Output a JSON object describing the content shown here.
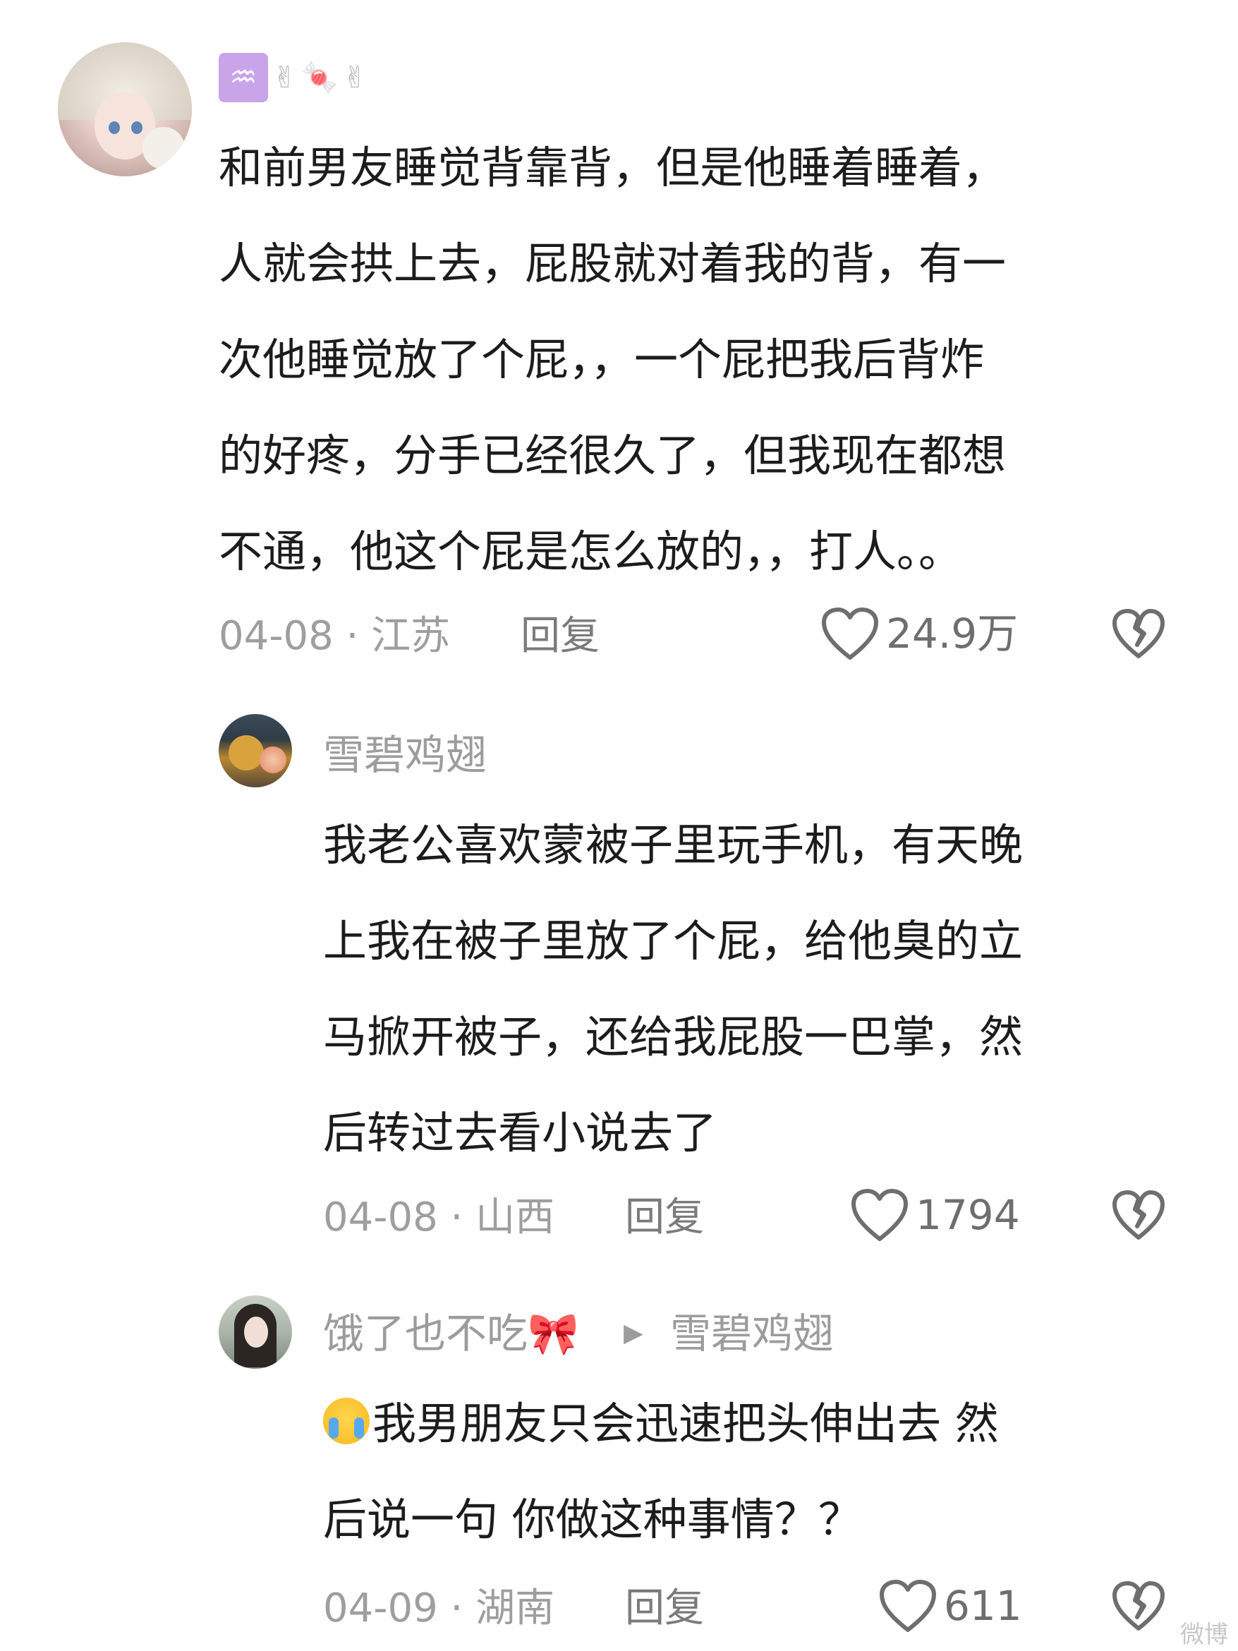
{
  "comments": [
    {
      "username_emojis": [
        "♒",
        "✌",
        "🍬",
        "✌"
      ],
      "text_lines": [
        "和前男友睡觉背靠背，但是他睡着睡着，",
        "人就会拱上去，屁股就对着我的背，有一",
        "次他睡觉放了个屁，，一个屁把我后背炸",
        "的好疼，分手已经很久了，但我现在都想",
        "不通，他这个屁是怎么放的，，打人。。"
      ],
      "date_location": "04-08 · 江苏",
      "reply_label": "回复",
      "likes": "24.9万"
    },
    {
      "username": "雪碧鸡翅",
      "text_lines": [
        "我老公喜欢蒙被子里玩手机，有天晚",
        "上我在被子里放了个屁，给他臭的立",
        "马掀开被子，还给我屁股一巴掌，然",
        "后转过去看小说去了"
      ],
      "date_location": "04-08 · 山西",
      "reply_label": "回复",
      "likes": "1794"
    },
    {
      "username": "饿了也不吃🎀",
      "reply_to": "雪碧鸡翅",
      "text_lines": [
        "我男朋友只会迅速把头伸出去 然",
        "后说一句 你做这种事情？？"
      ],
      "date_location": "04-09 · 湖南",
      "reply_label": "回复",
      "likes": "611"
    }
  ],
  "watermark": "微博"
}
